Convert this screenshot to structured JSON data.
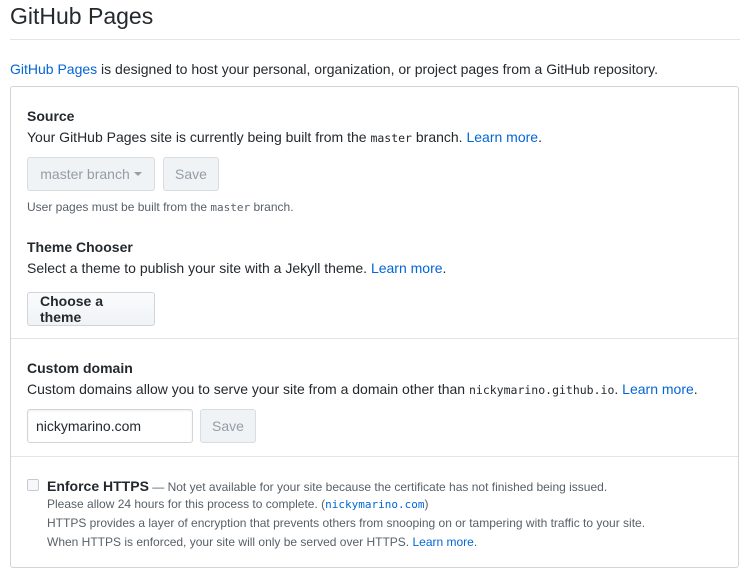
{
  "header": {
    "title": "GitHub Pages"
  },
  "intro": {
    "link": "GitHub Pages",
    "text": " is designed to host your personal, organization, or project pages from a GitHub repository."
  },
  "source": {
    "heading": "Source",
    "desc_before": "Your GitHub Pages site is currently being built from the ",
    "desc_code": "master",
    "desc_after": " branch. ",
    "learn_more": "Learn more",
    "period": ".",
    "branch_select": "master branch",
    "save_label": "Save",
    "note_before": "User pages must be built from the ",
    "note_code": "master",
    "note_after": " branch."
  },
  "theme": {
    "heading": "Theme Chooser",
    "desc": "Select a theme to publish your site with a Jekyll theme. ",
    "learn_more": "Learn more",
    "period": ".",
    "button": "Choose a theme"
  },
  "domain": {
    "heading": "Custom domain",
    "desc_before": "Custom domains allow you to serve your site from a domain other than ",
    "desc_code": "nickymarino.github.io",
    "desc_after": ". ",
    "learn_more": "Learn more",
    "period": ".",
    "input_value": "nickymarino.com",
    "save_label": "Save"
  },
  "https": {
    "label": "Enforce HTTPS",
    "dash": " — ",
    "sub": "Not yet available for your site because the certificate has not finished being issued.",
    "line2_before": "Please allow 24 hours for this process to complete. (",
    "line2_link": "nickymarino.com",
    "line2_after": ")",
    "line3": "HTTPS provides a layer of encryption that prevents others from snooping on or tampering with traffic to your site.",
    "line4": "When HTTPS is enforced, your site will only be served over HTTPS. ",
    "learn_more": "Learn more",
    "period": "."
  },
  "colors": {
    "link": "#0366d6",
    "border": "#d1d5da",
    "text": "#24292e"
  }
}
